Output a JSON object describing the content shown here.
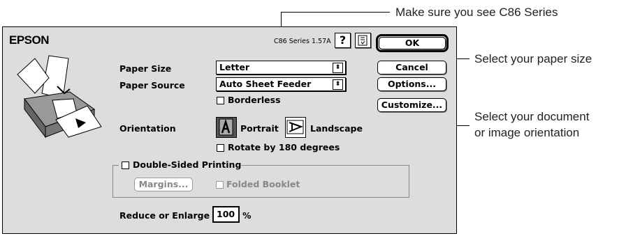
{
  "callouts": {
    "series": "Make sure you see C86 Series",
    "paper_size": "Select your paper size",
    "orientation_line1": "Select your document",
    "orientation_line2": "or image orientation"
  },
  "dialog": {
    "brand": "EPSON",
    "version": "C86 Series 1.57A",
    "help_glyph": "?",
    "ok": "OK",
    "cancel": "Cancel",
    "options": "Options...",
    "customize": "Customize...",
    "paper_size_label": "Paper Size",
    "paper_size_value": "Letter",
    "paper_source_label": "Paper Source",
    "paper_source_value": "Auto Sheet Feeder",
    "borderless": "Borderless",
    "orientation_label": "Orientation",
    "portrait": "Portrait",
    "landscape": "Landscape",
    "rotate": "Rotate by 180 degrees",
    "double_sided": "Double-Sided Printing",
    "margins": "Margins...",
    "folded_booklet": "Folded Booklet",
    "reduce_label": "Reduce or Enlarge",
    "reduce_value": "100",
    "percent": "%"
  }
}
